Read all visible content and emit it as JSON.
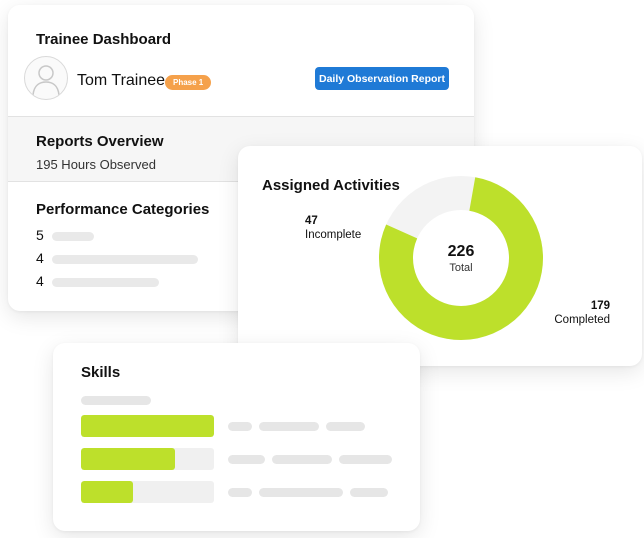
{
  "dashboard": {
    "title": "Trainee Dashboard",
    "trainee_name": "Tom Trainee",
    "phase_badge": "Phase 1",
    "report_button": "Daily Observation Report",
    "reports_title": "Reports Overview",
    "reports_subtitle": "195 Hours Observed",
    "performance_title": "Performance Categories",
    "performance_scores": [
      "5",
      "4",
      "4"
    ]
  },
  "activities": {
    "title": "Assigned Activities",
    "incomplete_value": "47",
    "incomplete_label": "Incomplete",
    "completed_value": "179",
    "completed_label": "Completed",
    "total_value": "226",
    "total_label": "Total"
  },
  "skills": {
    "title": "Skills",
    "levels": [
      1.0,
      0.71,
      0.39
    ]
  },
  "colors": {
    "accent_green": "#bde02b",
    "button_blue": "#1f7ad6",
    "badge_orange": "#f5a14b",
    "placeholder_grey": "#e9e9e9"
  },
  "icons": [
    "user-avatar-icon"
  ]
}
